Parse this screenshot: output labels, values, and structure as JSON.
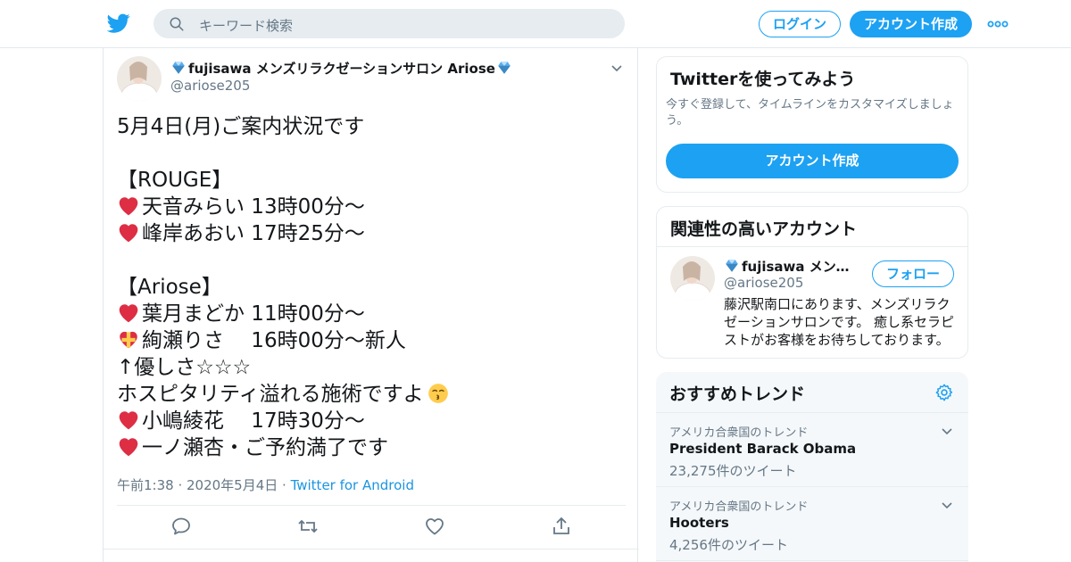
{
  "header": {
    "search_placeholder": "キーワード検索",
    "login_label": "ログイン",
    "signup_label": "アカウント作成"
  },
  "tweet": {
    "author_name": "fujisawa メンズリラクゼーションサロン Ariose",
    "author_handle": "@ariose205",
    "lines": [
      "5月4日(月)ご案内状況です",
      "",
      "【ROUGE】",
      "天音みらい 13時00分～",
      "峰岸あおい 17時25分～",
      "",
      "【Ariose】",
      "葉月まどか 11時00分～",
      "絢瀬りさ　 16時00分～新人",
      "↑優しさ☆☆☆",
      "ホスピタリティ溢れる施術ですよ",
      "小嶋綾花　 17時30分～",
      "一ノ瀬杏・ご予約満了です"
    ],
    "line_emoji": [
      "",
      "",
      "",
      "heart",
      "heart",
      "",
      "",
      "heart",
      "heart-ribbon",
      "",
      "",
      "heart",
      "heart"
    ],
    "trailing_emoji": [
      "",
      "",
      "",
      "",
      "",
      "",
      "",
      "",
      "",
      "",
      "kissing-face",
      "",
      ""
    ],
    "timestamp": "午前1:38 · 2020年5月4日",
    "separator": " · ",
    "source": "Twitter for Android"
  },
  "sidebar": {
    "try": {
      "title": "Twitterを使ってみよう",
      "description": "今すぐ登録して、タイムラインをカスタマイズしましょう。",
      "button": "アカウント作成"
    },
    "related": {
      "title": "関連性の高いアカウント",
      "name": "fujisawa メンズ…",
      "handle": "@ariose205",
      "follow": "フォロー",
      "bio": "藤沢駅南口にあります、メンズリラクゼーションサロンです。 癒し系セラピストがお客様をお待ちしております。"
    },
    "trends": {
      "title": "おすすめトレンド",
      "items": [
        {
          "context": "アメリカ合衆国のトレンド",
          "name": "President Barack Obama",
          "count": "23,275件のツイート"
        },
        {
          "context": "アメリカ合衆国のトレンド",
          "name": "Hooters",
          "count": "4,256件のツイート"
        }
      ]
    }
  },
  "colors": {
    "accent": "#1da1f2",
    "link": "#1b95e0",
    "muted": "#657786",
    "heart_emoji": "#dd2e44"
  }
}
